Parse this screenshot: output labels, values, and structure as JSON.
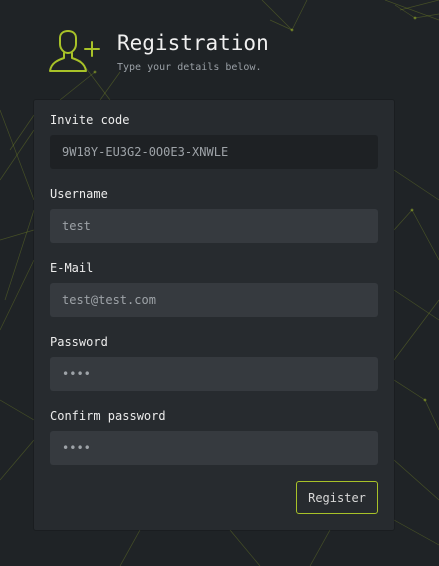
{
  "header": {
    "icon": "add-user-icon",
    "title": "Registration",
    "subtitle": "Type your details below."
  },
  "form": {
    "invite_code": {
      "label": "Invite code",
      "value": "9W18Y-EU3G2-0O0E3-XNWLE"
    },
    "username": {
      "label": "Username",
      "value": "test"
    },
    "email": {
      "label": "E-Mail",
      "value": "test@test.com"
    },
    "password": {
      "label": "Password",
      "value": "test"
    },
    "confirm_password": {
      "label": "Confirm password",
      "value": "test"
    },
    "submit_label": "Register"
  },
  "colors": {
    "accent": "#a8c228",
    "background": "#1f2326",
    "card": "#272b2f",
    "input": "#363a3f",
    "input_readonly": "#1e2124"
  }
}
